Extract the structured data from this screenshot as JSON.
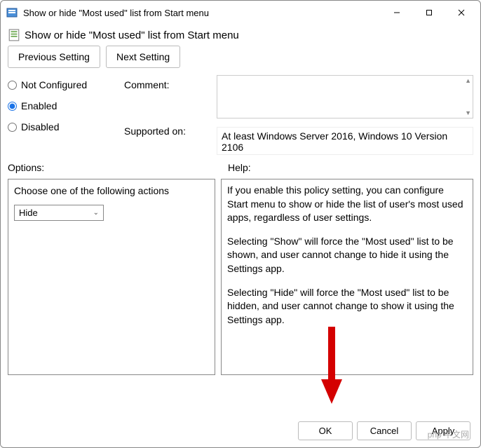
{
  "window": {
    "title": "Show or hide \"Most used\" list from Start menu"
  },
  "header": {
    "title": "Show or hide \"Most used\" list from Start menu"
  },
  "nav": {
    "prev": "Previous Setting",
    "next": "Next Setting"
  },
  "radios": {
    "not_configured": "Not Configured",
    "enabled": "Enabled",
    "disabled": "Disabled",
    "selected": "enabled"
  },
  "labels": {
    "comment": "Comment:",
    "supported_on": "Supported on:",
    "options": "Options:",
    "help": "Help:"
  },
  "supported_on_text": "At least Windows Server 2016, Windows 10 Version 2106",
  "options": {
    "prompt": "Choose one of the following actions",
    "selected": "Hide"
  },
  "help": {
    "p1": "If you enable this policy setting, you can configure Start menu to show or hide the list of user's most used apps, regardless of user settings.",
    "p2": "Selecting \"Show\" will force the \"Most used\" list to be shown, and user cannot change to hide it using the Settings app.",
    "p3": "Selecting \"Hide\" will force the \"Most used\" list to be hidden, and user cannot change to show it using the Settings app."
  },
  "footer": {
    "ok": "OK",
    "cancel": "Cancel",
    "apply": "Apply"
  },
  "watermark": "php 中文网"
}
